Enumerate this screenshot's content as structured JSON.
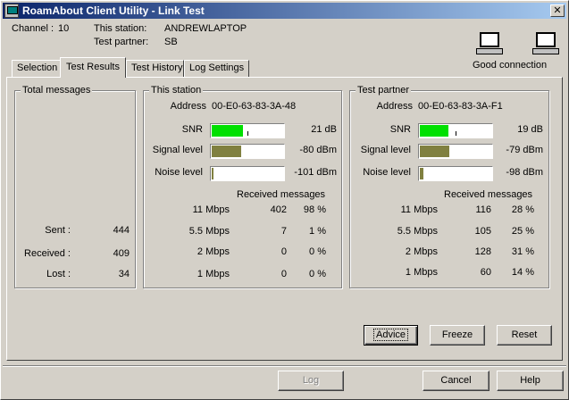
{
  "window": {
    "title": "RoamAbout Client Utility - Link Test",
    "close": "✕"
  },
  "header": {
    "channel_label": "Channel :",
    "channel_value": "10",
    "this_station_label": "This station:",
    "this_station_value": "ANDREWLAPTOP",
    "test_partner_label": "Test partner:",
    "test_partner_value": "SB",
    "connection_status": "Good connection"
  },
  "tabs": [
    {
      "label": "Selection"
    },
    {
      "label": "Test Results"
    },
    {
      "label": "Test History"
    },
    {
      "label": "Log Settings"
    }
  ],
  "total_messages": {
    "title": "Total messages",
    "sent_label": "Sent :",
    "sent_value": "444",
    "received_label": "Received :",
    "received_value": "409",
    "lost_label": "Lost :",
    "lost_value": "34"
  },
  "this_station": {
    "title": "This station",
    "address_label": "Address",
    "address_value": "00-E0-63-83-3A-48",
    "snr_label": "SNR",
    "snr_value": "21 dB",
    "snr_fraction": 0.43,
    "snr_tick_fraction": 0.5,
    "signal_label": "Signal level",
    "signal_value": "-80 dBm",
    "signal_fraction": 0.4,
    "noise_label": "Noise level",
    "noise_value": "-101 dBm",
    "noise_fraction": 0.0,
    "received_header": "Received messages",
    "rates": [
      {
        "rate": "11 Mbps",
        "count": "402",
        "pct": "98 %"
      },
      {
        "rate": "5.5 Mbps",
        "count": "7",
        "pct": "1 %"
      },
      {
        "rate": "2 Mbps",
        "count": "0",
        "pct": "0 %"
      },
      {
        "rate": "1 Mbps",
        "count": "0",
        "pct": "0 %"
      }
    ]
  },
  "test_partner": {
    "title": "Test partner",
    "address_label": "Address",
    "address_value": "00-E0-63-83-3A-F1",
    "snr_label": "SNR",
    "snr_value": "19 dB",
    "snr_fraction": 0.39,
    "snr_tick_fraction": 0.5,
    "signal_label": "Signal level",
    "signal_value": "-79 dBm",
    "signal_fraction": 0.4,
    "noise_label": "Noise level",
    "noise_value": "-98 dBm",
    "noise_fraction": 0.05,
    "received_header": "Received messages",
    "rates": [
      {
        "rate": "11 Mbps",
        "count": "116",
        "pct": "28 %"
      },
      {
        "rate": "5.5 Mbps",
        "count": "105",
        "pct": "25 %"
      },
      {
        "rate": "2 Mbps",
        "count": "128",
        "pct": "31 %"
      },
      {
        "rate": "1 Mbps",
        "count": "60",
        "pct": "14 %"
      }
    ]
  },
  "buttons": {
    "advice": "Advice",
    "freeze": "Freeze",
    "reset": "Reset",
    "log": "Log",
    "cancel": "Cancel",
    "help": "Help"
  },
  "colors": {
    "snr_bar": "#00e000",
    "signal_bar": "#808040",
    "noise_bar": "#808040"
  }
}
